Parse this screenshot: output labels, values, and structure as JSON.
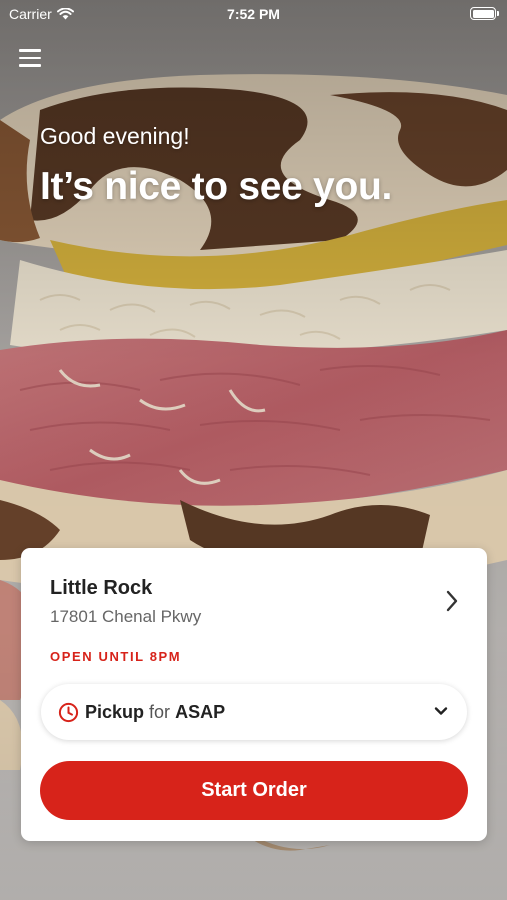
{
  "status_bar": {
    "carrier": "Carrier",
    "time": "7:52 PM",
    "icons": [
      "wifi-icon",
      "battery-icon"
    ]
  },
  "header": {
    "menu_icon": "hamburger-menu-icon"
  },
  "hero": {
    "greeting": "Good evening!",
    "headline": "It’s nice to see you."
  },
  "location_card": {
    "store_name": "Little Rock",
    "address": "17801 Chenal Pkwy",
    "hours": "OPEN UNTIL 8PM",
    "pickup": {
      "method": "Pickup",
      "connector": "for",
      "time": "ASAP"
    },
    "start_button_label": "Start Order"
  },
  "colors": {
    "accent": "#d7231a",
    "card_background": "#ffffff",
    "text_primary": "#222222",
    "text_secondary": "#666666"
  }
}
